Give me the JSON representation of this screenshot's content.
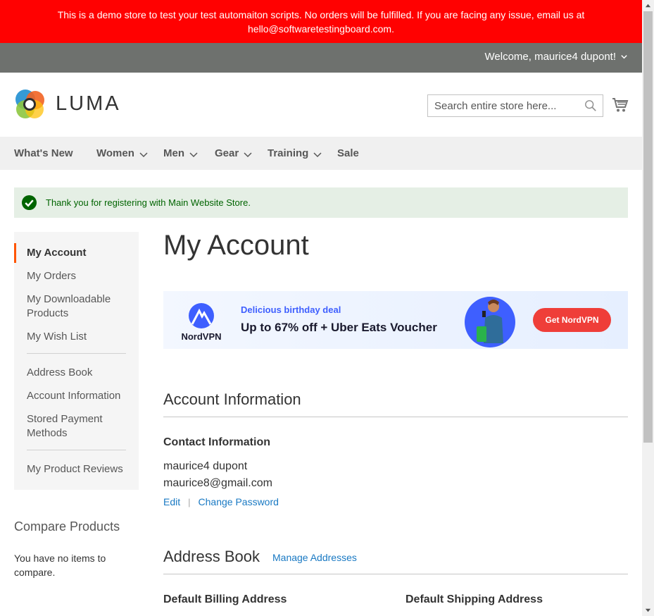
{
  "demo_banner": {
    "line1": "This is a demo store to test your test automaiton scripts. No orders will be fulfilled. If you are facing any issue, email us at",
    "line2": "hello@softwaretestingboard.com."
  },
  "header": {
    "welcome": "Welcome, maurice4 dupont!",
    "logo_text": "LUMA",
    "search_placeholder": "Search entire store here..."
  },
  "nav": {
    "items": [
      {
        "label": "What's New",
        "has_dropdown": false
      },
      {
        "label": "Women",
        "has_dropdown": true
      },
      {
        "label": "Men",
        "has_dropdown": true
      },
      {
        "label": "Gear",
        "has_dropdown": true
      },
      {
        "label": "Training",
        "has_dropdown": true
      },
      {
        "label": "Sale",
        "has_dropdown": false
      }
    ]
  },
  "message": {
    "success": "Thank you for registering with Main Website Store."
  },
  "sidebar": {
    "items": [
      {
        "label": "My Account",
        "current": true
      },
      {
        "label": "My Orders"
      },
      {
        "label": "My Downloadable Products"
      },
      {
        "label": "My Wish List"
      },
      {
        "label": "Address Book"
      },
      {
        "label": "Account Information"
      },
      {
        "label": "Stored Payment Methods"
      },
      {
        "label": "My Product Reviews"
      }
    ]
  },
  "compare": {
    "title": "Compare Products",
    "empty_text": "You have no items to compare."
  },
  "main": {
    "title": "My Account",
    "ad": {
      "brand": "NordVPN",
      "kicker": "Delicious birthday deal",
      "headline": "Up to 67% off + Uber Eats Voucher",
      "cta": "Get NordVPN"
    },
    "account_info": {
      "section_title": "Account Information",
      "box_title": "Contact Information",
      "name": "maurice4 dupont",
      "email": "maurice8@gmail.com",
      "edit_label": "Edit",
      "change_password_label": "Change Password"
    },
    "address_book": {
      "section_title": "Address Book",
      "manage_label": "Manage Addresses",
      "billing_title": "Default Billing Address",
      "shipping_title": "Default Shipping Address"
    }
  },
  "colors": {
    "banner_red": "#ff0101",
    "top_bar_gray": "#6e716e",
    "link_blue": "#1979c3",
    "success_green": "#006400",
    "accent_orange": "#ff5501",
    "cta_red": "#ef3e39"
  }
}
